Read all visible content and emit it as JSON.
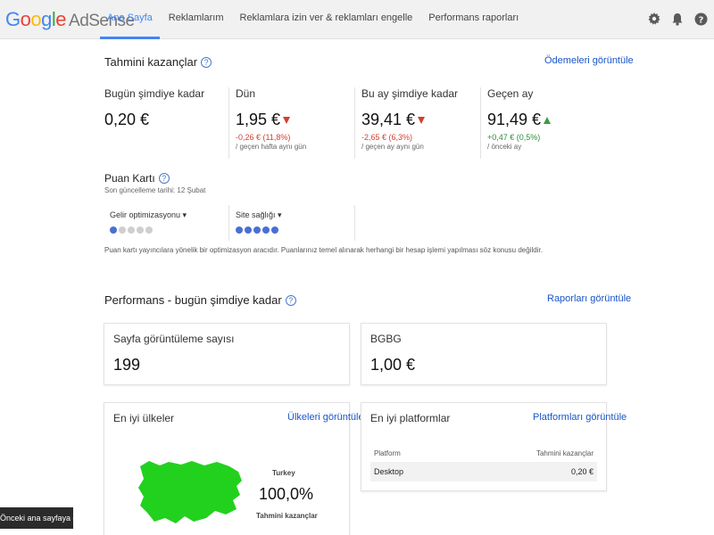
{
  "header": {
    "logo_google": [
      "G",
      "o",
      "o",
      "g",
      "l",
      "e"
    ],
    "logo_product": "AdSense",
    "tabs": [
      {
        "label": "Ana Sayfa",
        "active": true
      },
      {
        "label": "Reklamlarım",
        "active": false
      },
      {
        "label": "Reklamlara izin ver & reklamları engelle",
        "active": false
      },
      {
        "label": "Performans raporları",
        "active": false
      }
    ],
    "icons": [
      "gear-icon",
      "bell-icon",
      "help-icon"
    ]
  },
  "earnings": {
    "title": "Tahmini kazançlar",
    "link": "Ödemeleri görüntüle",
    "items": [
      {
        "label": "Bugün şimdiye kadar",
        "value": "0,20 €",
        "change": "",
        "compare": "",
        "trend": "none"
      },
      {
        "label": "Dün",
        "value": "1,95 €",
        "change": "-0,26 € (11,8%)",
        "compare": "/ geçen hafta aynı gün",
        "trend": "down"
      },
      {
        "label": "Bu ay şimdiye kadar",
        "value": "39,41 €",
        "change": "-2,65 € (6,3%)",
        "compare": "/ geçen ay aynı gün",
        "trend": "down"
      },
      {
        "label": "Geçen ay",
        "value": "91,49 €",
        "change": "+0,47 € (0,5%)",
        "compare": "/ önceki ay",
        "trend": "up"
      }
    ]
  },
  "scorecard": {
    "title": "Puan Kartı",
    "updated": "Son güncelleme tarihi: 12 Şubat",
    "items": [
      {
        "label": "Gelir optimizasyonu",
        "filled": 1,
        "total": 5
      },
      {
        "label": "Site sağlığı",
        "filled": 5,
        "total": 5
      }
    ],
    "note": "Puan kartı yayıncılara yönelik bir optimizasyon aracıdır. Puanlarınız temel alınarak herhangi bir hesap işlemi yapılması söz konusu değildir."
  },
  "performance": {
    "title": "Performans - bugün şimdiye kadar",
    "link": "Raporları görüntüle",
    "pageviews": {
      "label": "Sayfa görüntüleme sayısı",
      "value": "199"
    },
    "bgbg": {
      "label": "BGBG",
      "value": "1,00 €"
    },
    "countries": {
      "title": "En iyi ülkeler",
      "link": "Ülkeleri görüntüle",
      "country": "Turkey",
      "share": "100,0%",
      "metric": "Tahmini kazançlar",
      "map_color": "#22d11e"
    },
    "platforms": {
      "title": "En iyi platformlar",
      "link": "Platformları görüntüle",
      "col_platform": "Platform",
      "col_earnings": "Tahmini kazançlar",
      "rows": [
        {
          "platform": "Desktop",
          "earnings": "0,20 €"
        }
      ]
    }
  },
  "back_button": "Önceki ana sayfaya dön",
  "colors": {
    "accent": "#4285f4",
    "link": "#1a55c7",
    "negative": "#d23f31",
    "positive": "#2d8f3d"
  }
}
